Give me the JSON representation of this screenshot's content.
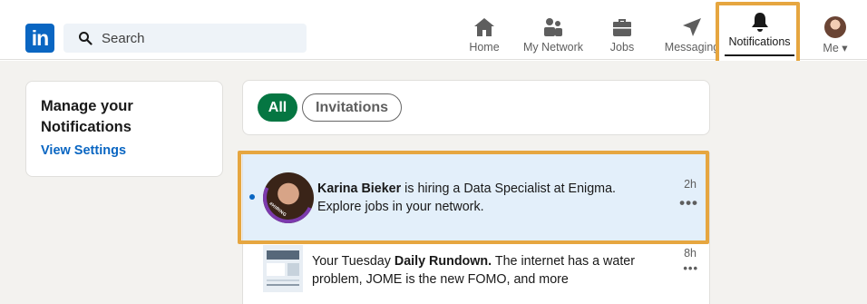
{
  "header": {
    "logo_text": "in",
    "search_placeholder": "Search"
  },
  "nav": [
    {
      "label": "Home",
      "icon": "home-icon"
    },
    {
      "label": "My Network",
      "icon": "people-icon"
    },
    {
      "label": "Jobs",
      "icon": "briefcase-icon"
    },
    {
      "label": "Messaging",
      "icon": "send-icon"
    },
    {
      "label": "Notifications",
      "icon": "bell-icon",
      "active": true
    },
    {
      "label": "Me",
      "icon": "avatar-icon"
    }
  ],
  "sidebar": {
    "title": "Manage your Notifications",
    "link": "View Settings"
  },
  "filters": {
    "all": "All",
    "invitations": "Invitations"
  },
  "notifications": [
    {
      "name": "Karina Bieker",
      "text": " is hiring a Data Specialist at Enigma. Explore jobs in your network.",
      "time": "2h",
      "unread": true,
      "badge": "#HIRING"
    },
    {
      "prefix": "Your Tuesday ",
      "bold": "Daily Rundown.",
      "text": " The internet has a water problem, JOME is the new FOMO, and more",
      "time": "8h"
    }
  ],
  "colors": {
    "brand": "#0a66c2",
    "all_pill": "#057642",
    "highlight": "#e6a640",
    "unread_bg": "#e3effa"
  }
}
